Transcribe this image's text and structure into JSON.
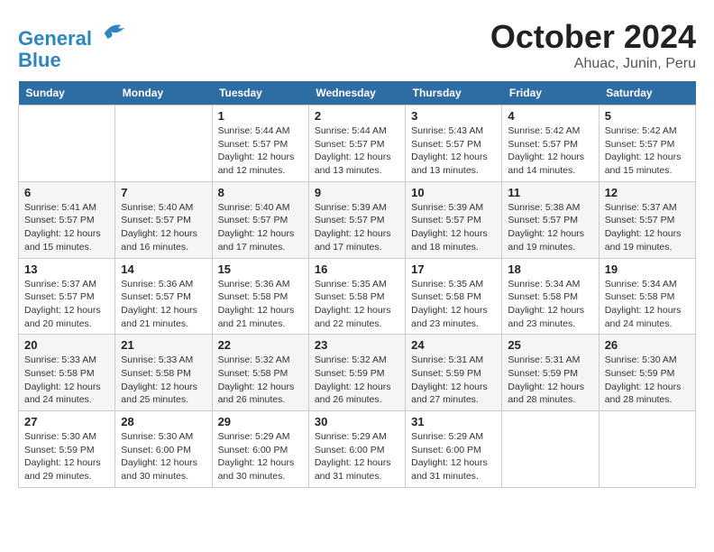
{
  "header": {
    "logo_line1": "General",
    "logo_line2": "Blue",
    "month": "October 2024",
    "location": "Ahuac, Junin, Peru"
  },
  "days_of_week": [
    "Sunday",
    "Monday",
    "Tuesday",
    "Wednesday",
    "Thursday",
    "Friday",
    "Saturday"
  ],
  "weeks": [
    [
      {
        "day": "",
        "info": ""
      },
      {
        "day": "",
        "info": ""
      },
      {
        "day": "1",
        "info": "Sunrise: 5:44 AM\nSunset: 5:57 PM\nDaylight: 12 hours\nand 12 minutes."
      },
      {
        "day": "2",
        "info": "Sunrise: 5:44 AM\nSunset: 5:57 PM\nDaylight: 12 hours\nand 13 minutes."
      },
      {
        "day": "3",
        "info": "Sunrise: 5:43 AM\nSunset: 5:57 PM\nDaylight: 12 hours\nand 13 minutes."
      },
      {
        "day": "4",
        "info": "Sunrise: 5:42 AM\nSunset: 5:57 PM\nDaylight: 12 hours\nand 14 minutes."
      },
      {
        "day": "5",
        "info": "Sunrise: 5:42 AM\nSunset: 5:57 PM\nDaylight: 12 hours\nand 15 minutes."
      }
    ],
    [
      {
        "day": "6",
        "info": "Sunrise: 5:41 AM\nSunset: 5:57 PM\nDaylight: 12 hours\nand 15 minutes."
      },
      {
        "day": "7",
        "info": "Sunrise: 5:40 AM\nSunset: 5:57 PM\nDaylight: 12 hours\nand 16 minutes."
      },
      {
        "day": "8",
        "info": "Sunrise: 5:40 AM\nSunset: 5:57 PM\nDaylight: 12 hours\nand 17 minutes."
      },
      {
        "day": "9",
        "info": "Sunrise: 5:39 AM\nSunset: 5:57 PM\nDaylight: 12 hours\nand 17 minutes."
      },
      {
        "day": "10",
        "info": "Sunrise: 5:39 AM\nSunset: 5:57 PM\nDaylight: 12 hours\nand 18 minutes."
      },
      {
        "day": "11",
        "info": "Sunrise: 5:38 AM\nSunset: 5:57 PM\nDaylight: 12 hours\nand 19 minutes."
      },
      {
        "day": "12",
        "info": "Sunrise: 5:37 AM\nSunset: 5:57 PM\nDaylight: 12 hours\nand 19 minutes."
      }
    ],
    [
      {
        "day": "13",
        "info": "Sunrise: 5:37 AM\nSunset: 5:57 PM\nDaylight: 12 hours\nand 20 minutes."
      },
      {
        "day": "14",
        "info": "Sunrise: 5:36 AM\nSunset: 5:57 PM\nDaylight: 12 hours\nand 21 minutes."
      },
      {
        "day": "15",
        "info": "Sunrise: 5:36 AM\nSunset: 5:58 PM\nDaylight: 12 hours\nand 21 minutes."
      },
      {
        "day": "16",
        "info": "Sunrise: 5:35 AM\nSunset: 5:58 PM\nDaylight: 12 hours\nand 22 minutes."
      },
      {
        "day": "17",
        "info": "Sunrise: 5:35 AM\nSunset: 5:58 PM\nDaylight: 12 hours\nand 23 minutes."
      },
      {
        "day": "18",
        "info": "Sunrise: 5:34 AM\nSunset: 5:58 PM\nDaylight: 12 hours\nand 23 minutes."
      },
      {
        "day": "19",
        "info": "Sunrise: 5:34 AM\nSunset: 5:58 PM\nDaylight: 12 hours\nand 24 minutes."
      }
    ],
    [
      {
        "day": "20",
        "info": "Sunrise: 5:33 AM\nSunset: 5:58 PM\nDaylight: 12 hours\nand 24 minutes."
      },
      {
        "day": "21",
        "info": "Sunrise: 5:33 AM\nSunset: 5:58 PM\nDaylight: 12 hours\nand 25 minutes."
      },
      {
        "day": "22",
        "info": "Sunrise: 5:32 AM\nSunset: 5:58 PM\nDaylight: 12 hours\nand 26 minutes."
      },
      {
        "day": "23",
        "info": "Sunrise: 5:32 AM\nSunset: 5:59 PM\nDaylight: 12 hours\nand 26 minutes."
      },
      {
        "day": "24",
        "info": "Sunrise: 5:31 AM\nSunset: 5:59 PM\nDaylight: 12 hours\nand 27 minutes."
      },
      {
        "day": "25",
        "info": "Sunrise: 5:31 AM\nSunset: 5:59 PM\nDaylight: 12 hours\nand 28 minutes."
      },
      {
        "day": "26",
        "info": "Sunrise: 5:30 AM\nSunset: 5:59 PM\nDaylight: 12 hours\nand 28 minutes."
      }
    ],
    [
      {
        "day": "27",
        "info": "Sunrise: 5:30 AM\nSunset: 5:59 PM\nDaylight: 12 hours\nand 29 minutes."
      },
      {
        "day": "28",
        "info": "Sunrise: 5:30 AM\nSunset: 6:00 PM\nDaylight: 12 hours\nand 30 minutes."
      },
      {
        "day": "29",
        "info": "Sunrise: 5:29 AM\nSunset: 6:00 PM\nDaylight: 12 hours\nand 30 minutes."
      },
      {
        "day": "30",
        "info": "Sunrise: 5:29 AM\nSunset: 6:00 PM\nDaylight: 12 hours\nand 31 minutes."
      },
      {
        "day": "31",
        "info": "Sunrise: 5:29 AM\nSunset: 6:00 PM\nDaylight: 12 hours\nand 31 minutes."
      },
      {
        "day": "",
        "info": ""
      },
      {
        "day": "",
        "info": ""
      }
    ]
  ]
}
